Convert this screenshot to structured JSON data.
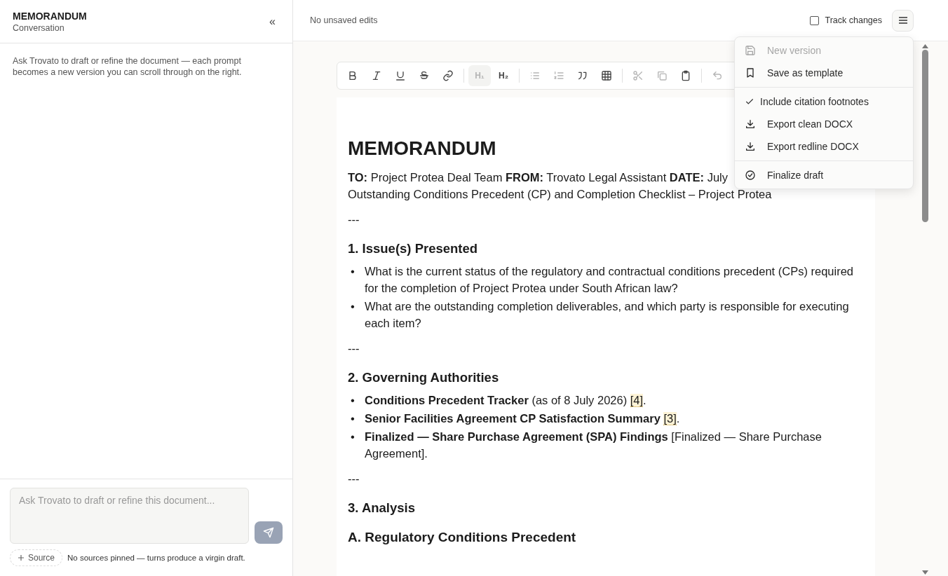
{
  "sidebar": {
    "title": "MEMORANDUM",
    "subtitle": "Conversation",
    "collapse_icon": "«",
    "intro": "Ask Trovato to draft or refine the document — each prompt becomes a new version you can scroll through on the right.",
    "prompt": {
      "placeholder": "Ask Trovato to draft or refine this document..."
    },
    "source_button": "Source",
    "sources_note": "No sources pinned — turns produce a virgin draft."
  },
  "topbar": {
    "status": "No unsaved edits",
    "track_changes": {
      "label": "Track changes",
      "checked": false
    }
  },
  "toolbar": [
    {
      "kind": "bold",
      "disabled": false,
      "selected": false
    },
    {
      "kind": "italic",
      "disabled": false,
      "selected": false
    },
    {
      "kind": "underline",
      "disabled": false,
      "selected": false
    },
    {
      "kind": "strike",
      "disabled": false,
      "selected": false
    },
    {
      "kind": "link",
      "disabled": false,
      "selected": false
    },
    {
      "kind": "sep"
    },
    {
      "kind": "heading",
      "label": "H₁",
      "disabled": true,
      "selected": true
    },
    {
      "kind": "heading",
      "label": "H₂",
      "disabled": false,
      "selected": false
    },
    {
      "kind": "sep"
    },
    {
      "kind": "bullets",
      "disabled": true,
      "selected": false
    },
    {
      "kind": "numbers",
      "disabled": true,
      "selected": false
    },
    {
      "kind": "quote",
      "disabled": false,
      "selected": false
    },
    {
      "kind": "table",
      "disabled": false,
      "selected": false
    },
    {
      "kind": "sep"
    },
    {
      "kind": "cut",
      "disabled": true,
      "selected": false
    },
    {
      "kind": "copy",
      "disabled": true,
      "selected": false
    },
    {
      "kind": "paste",
      "disabled": false,
      "selected": false
    },
    {
      "kind": "sep"
    },
    {
      "kind": "undo",
      "disabled": true,
      "selected": false
    }
  ],
  "document": [
    {
      "kind": "title",
      "text": "MEMORANDUM"
    },
    {
      "kind": "line",
      "text": "**TO:** Project Protea Deal Team **FROM:** Trovato Legal Assistant **DATE:** July"
    },
    {
      "kind": "line",
      "text": "Outstanding Conditions Precedent (CP) and Completion Checklist – Project Protea"
    },
    {
      "kind": "rule",
      "text": "---"
    },
    {
      "kind": "heading",
      "text": "1. Issue(s) Presented"
    },
    {
      "kind": "list",
      "items": [
        {
          "marker": "•",
          "text": "What is the current status of the regulatory and contractual conditions precedent (CPs) required for the completion of Project Protea under South African law?"
        },
        {
          "marker": "•",
          "text": "What are the outstanding completion deliverables, and which party is responsible for executing each item?"
        }
      ]
    },
    {
      "kind": "rule",
      "text": "---"
    },
    {
      "kind": "heading",
      "text": "2. Governing Authorities"
    },
    {
      "kind": "list",
      "items": [
        {
          "marker": "•",
          "lead": "Conditions Precedent Tracker",
          "text": " (as of 8 July 2026) ",
          "cite": "[4]",
          "end": "."
        },
        {
          "marker": "•",
          "lead": "Senior Facilities Agreement CP Satisfaction Summary",
          "cite": "[3]",
          "end": "."
        },
        {
          "marker": "•",
          "lead": "Finalized — Share Purchase Agreement (SPA) Findings",
          "text": " [Finalized — Share Purchase Agreement]."
        }
      ]
    },
    {
      "kind": "rule",
      "text": "---"
    },
    {
      "kind": "heading",
      "text": "3. Analysis"
    },
    {
      "kind": "subheading",
      "text": "A. Regulatory Conditions Precedent"
    }
  ],
  "menu": [
    {
      "kind": "save",
      "label": "New version",
      "disabled": true
    },
    {
      "kind": "bookmark",
      "label": "Save as template",
      "disabled": false
    },
    {
      "kind": "sep"
    },
    {
      "kind": "check",
      "label": "Include citation footnotes",
      "checked": true
    },
    {
      "kind": "download",
      "label": "Export clean DOCX",
      "disabled": false
    },
    {
      "kind": "download",
      "label": "Export redline DOCX",
      "disabled": false
    },
    {
      "kind": "sep"
    },
    {
      "kind": "finalize",
      "label": "Finalize draft",
      "disabled": false
    }
  ]
}
